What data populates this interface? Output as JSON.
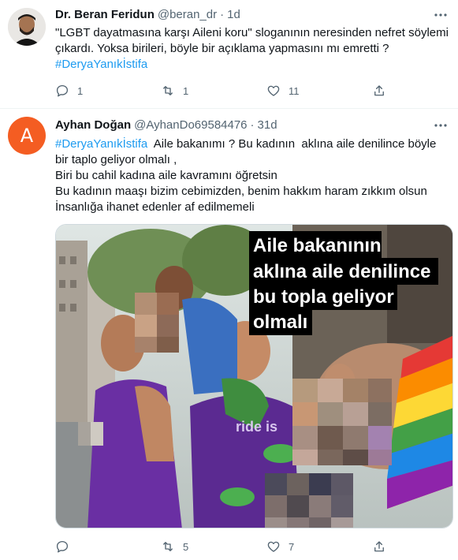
{
  "tweets": [
    {
      "author_name": "Dr. Beran Feridun",
      "handle": "@beran_dr",
      "separator": "·",
      "time": "1d",
      "text_lines": [
        "\"LGBT dayatmasına karşı Aileni koru\" sloganının neresinden nefret söylemi",
        "çıkardı. Yoksa birileri, böyle bir açıklama yapmasını mı emretti ?"
      ],
      "hashtag": "#DeryaYanıkİstifa",
      "replies": "1",
      "retweets": "1",
      "likes": "11"
    },
    {
      "author_name": "Ayhan Doğan",
      "handle": "@AyhanDo69584476",
      "separator": "·",
      "time": "31d",
      "avatar_letter": "A",
      "hashtag": "#DeryaYanıkİstifa",
      "first_line_rest": "  Aile bakanımı ? Bu kadının  aklına aile denilince böyle",
      "text_lines": [
        "bir taplo geliyor olmalı ,",
        "Biri bu cahil kadına aile kavramını öğretsin",
        "Bu kadının maaşı bizim cebimizden, benim hakkım haram zıkkım olsun",
        "İnsanlığa ihanet edenler af edilmemeli"
      ],
      "image_caption_lines": [
        "Aile bakanının",
        "aklına aile denilince",
        "bu topla geliyor",
        "olmalı"
      ],
      "shirt_text": "ride is",
      "replies": "",
      "retweets": "5",
      "likes": "7"
    }
  ],
  "colors": {
    "accent": "#1d9bf0",
    "muted": "#536471",
    "avatar_orange": "#f45d22"
  }
}
